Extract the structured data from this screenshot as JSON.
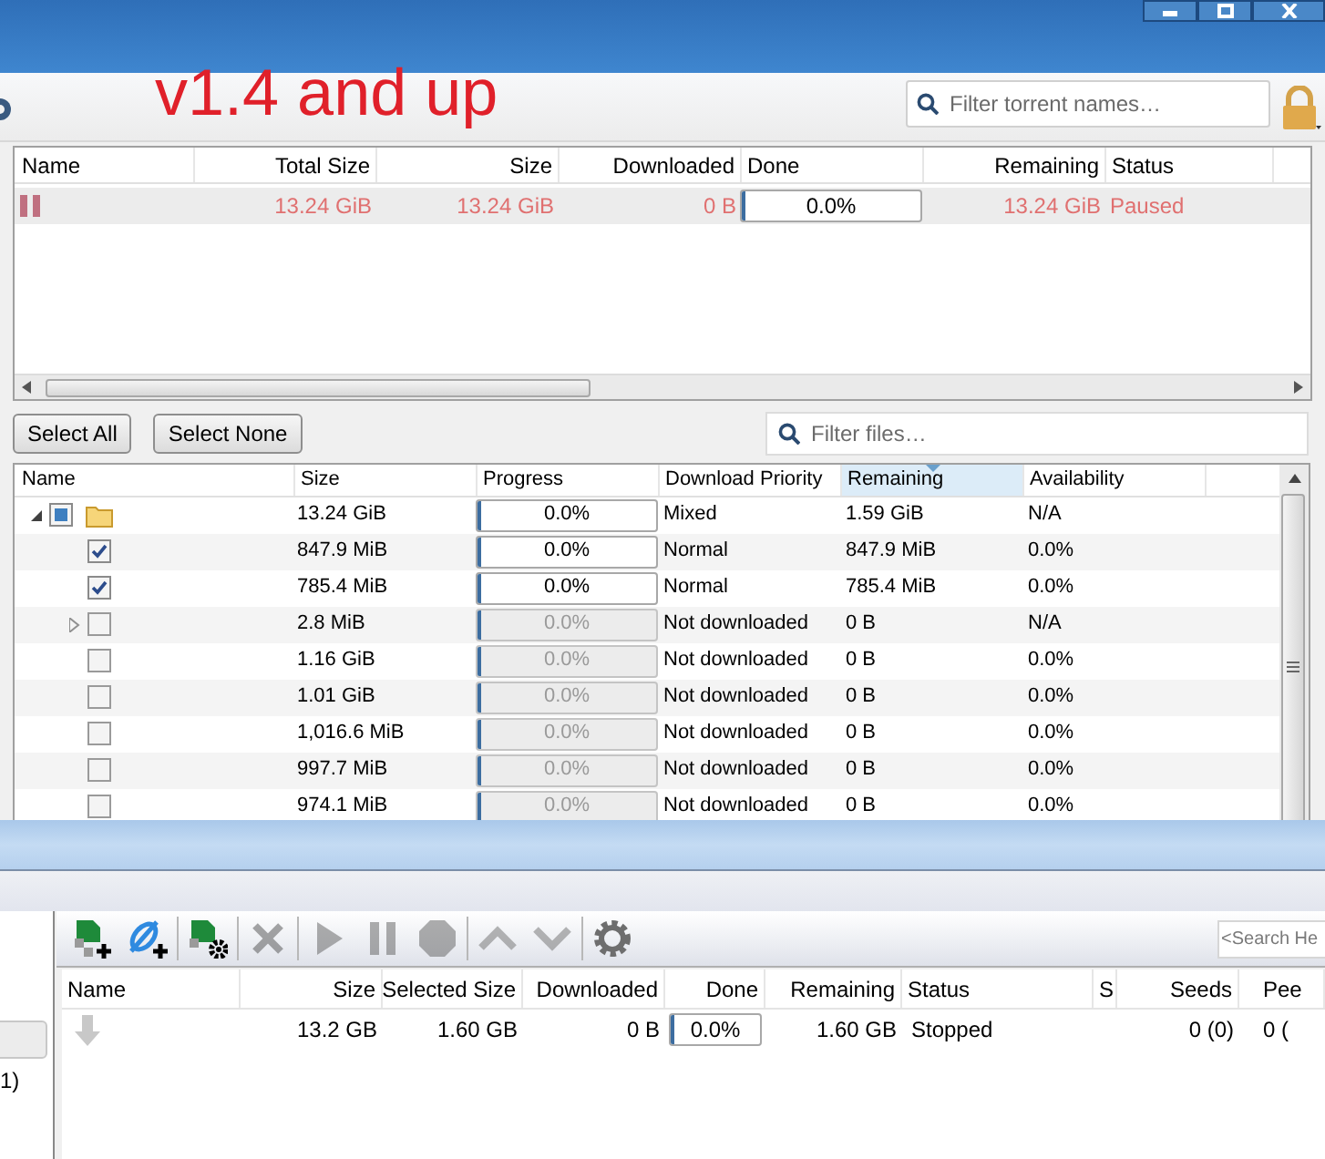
{
  "banner": "v1.4 and up",
  "torrent_filter": {
    "placeholder": "Filter torrent names…"
  },
  "torrent_table": {
    "columns": [
      "Name",
      "Total Size",
      "Size",
      "Downloaded",
      "Done",
      "Remaining",
      "Status"
    ],
    "rows": [
      {
        "kind": "paused",
        "total_size": "13.24 GiB",
        "size": "13.24 GiB",
        "downloaded": "0 B",
        "done": {
          "text": "0.0%",
          "level": 0
        },
        "remaining": "13.24 GiB",
        "status": "Paused"
      }
    ]
  },
  "file_panel": {
    "buttons": [
      "Select All",
      "Select None"
    ],
    "filter": {
      "placeholder": "Filter files…"
    },
    "columns": [
      {
        "label": "Name",
        "sorted": false
      },
      {
        "label": "Size",
        "sorted": false
      },
      {
        "label": "Progress",
        "sorted": false
      },
      {
        "label": "Download Priority",
        "sorted": false
      },
      {
        "label": "Remaining",
        "sorted": true
      },
      {
        "label": "Availability",
        "sorted": false
      }
    ],
    "tree": [
      {
        "kind": "folder",
        "checked": false,
        "partial": true,
        "expanded": true,
        "size": "13.24 GiB",
        "progress": {
          "text": "0.0%",
          "level": 0
        },
        "priority": "Mixed",
        "remaining": "1.59 GiB",
        "availability": "N/A",
        "children": [
          {
            "checked": true,
            "partial": false,
            "size": "847.9 MiB",
            "progress": {
              "text": "0.0%",
              "level": 0
            },
            "priority": "Normal",
            "remaining": "847.9 MiB",
            "availability": "0.0%"
          },
          {
            "checked": true,
            "partial": false,
            "size": "785.4 MiB",
            "progress": {
              "text": "0.0%",
              "level": 0
            },
            "priority": "Normal",
            "remaining": "785.4 MiB",
            "availability": "0.0%"
          },
          {
            "checked": false,
            "partial": false,
            "expanded": false,
            "size": "2.8 MiB",
            "progress": {
              "text": "0.0%",
              "level": 0
            },
            "priority": "Not downloaded",
            "remaining": "0 B",
            "availability": "N/A"
          },
          {
            "checked": false,
            "partial": false,
            "size": "1.16 GiB",
            "progress": {
              "text": "0.0%",
              "level": 0
            },
            "priority": "Not downloaded",
            "remaining": "0 B",
            "availability": "0.0%"
          },
          {
            "checked": false,
            "partial": false,
            "size": "1.01 GiB",
            "progress": {
              "text": "0.0%",
              "level": 0
            },
            "priority": "Not downloaded",
            "remaining": "0 B",
            "availability": "0.0%"
          },
          {
            "checked": false,
            "partial": false,
            "size": "1,016.6 MiB",
            "progress": {
              "text": "0.0%",
              "level": 0
            },
            "priority": "Not downloaded",
            "remaining": "0 B",
            "availability": "0.0%"
          },
          {
            "checked": false,
            "partial": false,
            "size": "997.7 MiB",
            "progress": {
              "text": "0.0%",
              "level": 0
            },
            "priority": "Not downloaded",
            "remaining": "0 B",
            "availability": "0.0%"
          },
          {
            "checked": false,
            "partial": false,
            "size": "974.1 MiB",
            "progress": {
              "text": "0.0%",
              "level": 0
            },
            "priority": "Not downloaded",
            "remaining": "0 B",
            "availability": "0.0%"
          }
        ]
      }
    ]
  },
  "lower": {
    "toolbar": [
      {
        "kind": "add-file",
        "disabled": false
      },
      {
        "kind": "add-link",
        "disabled": false
      },
      {
        "kind": "file-settings",
        "disabled": false
      },
      {
        "kind": "remove",
        "disabled": true
      },
      {
        "kind": "play",
        "disabled": true
      },
      {
        "kind": "pause",
        "disabled": true
      },
      {
        "kind": "stop",
        "disabled": true
      },
      {
        "kind": "up",
        "disabled": true
      },
      {
        "kind": "down",
        "disabled": true
      },
      {
        "kind": "settings",
        "disabled": false
      }
    ],
    "search": {
      "placeholder": "<Search He"
    },
    "side_text": "1)",
    "columns": [
      "Name",
      "Size",
      "Selected Size",
      "Downloaded",
      "Done",
      "Remaining",
      "Status",
      "S",
      "Seeds",
      "Pee"
    ],
    "rows": [
      {
        "kind": "stopped",
        "size": "13.2 GB",
        "selected_size": "1.60 GB",
        "downloaded": "0 B",
        "done": {
          "text": "0.0%",
          "level": 0
        },
        "remaining": "1.60 GB",
        "status": "Stopped",
        "seeds": "0 (0)",
        "peers": "0 ("
      }
    ]
  }
}
